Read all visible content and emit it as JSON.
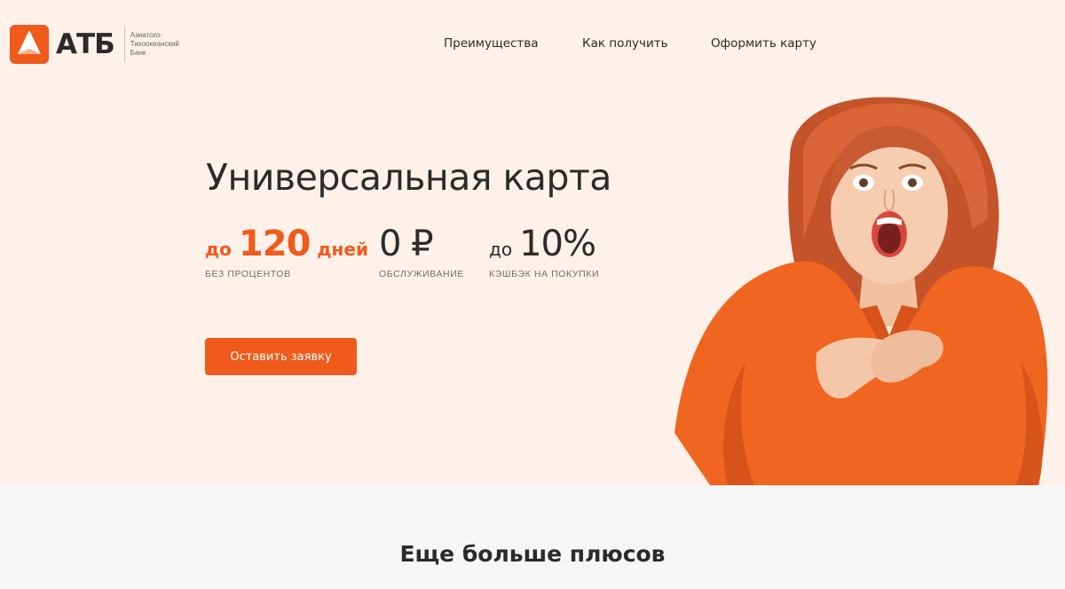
{
  "header": {
    "logo_text": "АТБ",
    "logo_subtitle": "Азиатско-Тихоокеанский Банк",
    "nav": [
      "Преимущества",
      "Как получить",
      "Оформить карту"
    ]
  },
  "hero": {
    "title": "Универсальная карта",
    "stats": [
      {
        "prefix": "до",
        "value": "120",
        "suffix": "дней",
        "caption": "БЕЗ ПРОЦЕНТОВ"
      },
      {
        "prefix": "",
        "value": "0 ₽",
        "suffix": "",
        "caption": "ОБСЛУЖИВАНИЕ"
      },
      {
        "prefix": "до",
        "value": "10%",
        "suffix": "",
        "caption": "КЭШБЭК НА ПОКУПКИ"
      }
    ],
    "cta_label": "Оставить заявку",
    "photo": "excited-woman-orange-shirt"
  },
  "section": {
    "title": "Еще больше плюсов"
  },
  "colors": {
    "accent": "#f05a1a",
    "hero_bg": "#fdf1ea",
    "page_bg": "#f6f6f6",
    "text": "#2b2b2b"
  }
}
